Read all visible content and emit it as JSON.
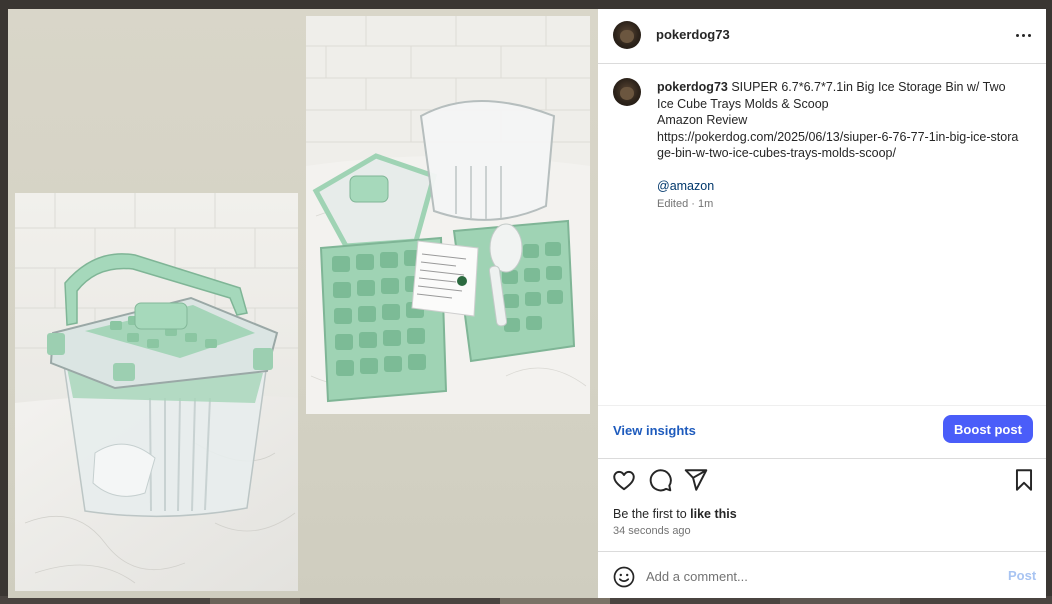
{
  "post": {
    "username": "pokerdog73",
    "caption": {
      "username": "pokerdog73",
      "title": "SIUPER 6.7*6.7*7.1in Big Ice Storage Bin w/ Two Ice Cube Trays Molds & Scoop",
      "line2": "Amazon Review",
      "link": "https://pokerdog.com/2025/06/13/siuper-6-76-77-1in-big-ice-storage-bin-w-two-ice-cubes-trays-molds-scoop/",
      "mention": "@amazon"
    },
    "edited": "Edited · 1m",
    "view_insights": "View insights",
    "boost": "Boost post",
    "likes_prefix": "Be the first to ",
    "likes_bold": "like this",
    "timestamp": "34 seconds ago",
    "comment_placeholder": "Add a comment...",
    "post_button": "Post"
  },
  "icons": {
    "more": "more-options-icon",
    "like": "heart-icon",
    "comment": "comment-bubble-icon",
    "share": "paper-plane-icon",
    "save": "bookmark-icon",
    "emoji": "smiley-icon"
  },
  "colors": {
    "link_blue": "#1e5bbd",
    "boost_button": "#4a5df9",
    "tray_green": "#9fd3b4",
    "post_disabled": "#a8c4f2"
  }
}
